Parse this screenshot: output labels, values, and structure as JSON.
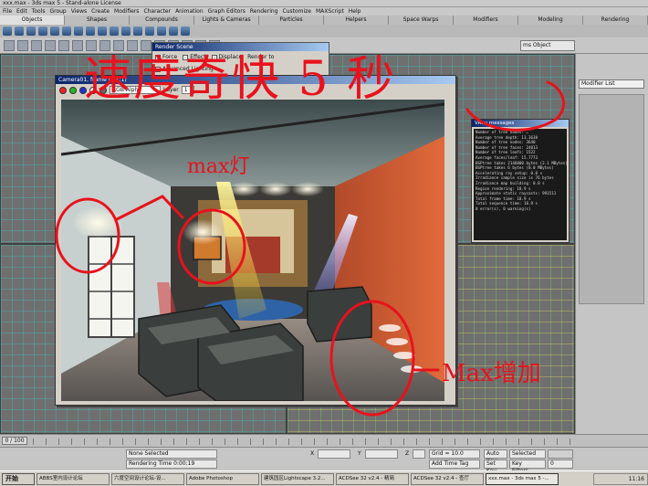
{
  "window": {
    "title": "xxx.max - 3ds max 5 - Stand-alone License"
  },
  "menu": [
    "File",
    "Edit",
    "Tools",
    "Group",
    "Views",
    "Create",
    "Modifiers",
    "Character",
    "Animation",
    "Graph Editors",
    "Rendering",
    "Customize",
    "MAXScript",
    "Help"
  ],
  "tabs": [
    "Objects",
    "Shapes",
    "Compounds",
    "Lights & Cameras",
    "Particles",
    "Helpers",
    "Space Warps",
    "Modifiers",
    "Modeling",
    "Rendering"
  ],
  "toolbar": {
    "named_selection": "ms Object",
    "view_dropdown": "View"
  },
  "command_panel": {
    "modifier_list": "Modifier List"
  },
  "render_settings": {
    "title": "Render Scene",
    "force_label": "Force",
    "effects_label": "Effect",
    "displacement_label": "Displace",
    "render_to_label": "Render to",
    "advanced_lighting_label": "Advanced Lighting"
  },
  "frame_window": {
    "title": "Camera01, frame 0 (1:1)",
    "channel": "RGB Alpha",
    "layer_label": "Layer",
    "layer_value": "1"
  },
  "vray": {
    "title": "VRay messages",
    "lines": [
      "Number of tree nodes: …",
      "Average tree depth: 13.3638",
      "Number of tree nodes: 3640",
      "Number of tree faces: 24013",
      "Number of tree leafs: 1522",
      "Average faces/leaf: 15.7773",
      "BSPtree takes 2146000 bytes (2.1 MBytes)",
      "BSPtree takes 6 bytes (0.0 MBytes)",
      "Accelerating ray setup: 0.0 s",
      "Irradiance sample size is 76 bytes",
      "Irradiance map building: 0.0 s",
      "Region rendering: 18.9 s",
      "Approximate static raycasts: 991511",
      "Total frame time: 18.9 s",
      "Total sequence time: 18.9 s",
      "0 error(s), 0 warning(s)"
    ]
  },
  "timeline": {
    "frame_position": "0 / 100"
  },
  "status": {
    "selection": "None Selected",
    "render_time": "Rendering Time  0:00:19",
    "grid": "Grid = 10.0",
    "add_time_tag": "Add Time Tag",
    "x_label": "X",
    "y_label": "Y",
    "z_label": "Z",
    "auto_key": "Auto Key",
    "set_key": "Set Key",
    "key_selection": "Selected",
    "key_filters": "Key Filters...",
    "frame": "0"
  },
  "taskbar": {
    "start": "开始",
    "tasks": [
      "ABBS室内设计论坛",
      "六度空间设计论坛-设...",
      "Adobe Photoshop",
      "建筑园区Lightscape 3.2...",
      "ACDSee 32 v2.4 - 精简",
      "ACDSee 32 v2.4 - 查厅",
      "xxx.max - 3ds max 5 -..."
    ],
    "clock": "11:16"
  },
  "annotations": {
    "top_text": "速度奇快 5 秒",
    "light_label_left": "max灯",
    "light_label_right": "Max增加",
    "colors": {
      "ink": "#e8121c"
    }
  }
}
